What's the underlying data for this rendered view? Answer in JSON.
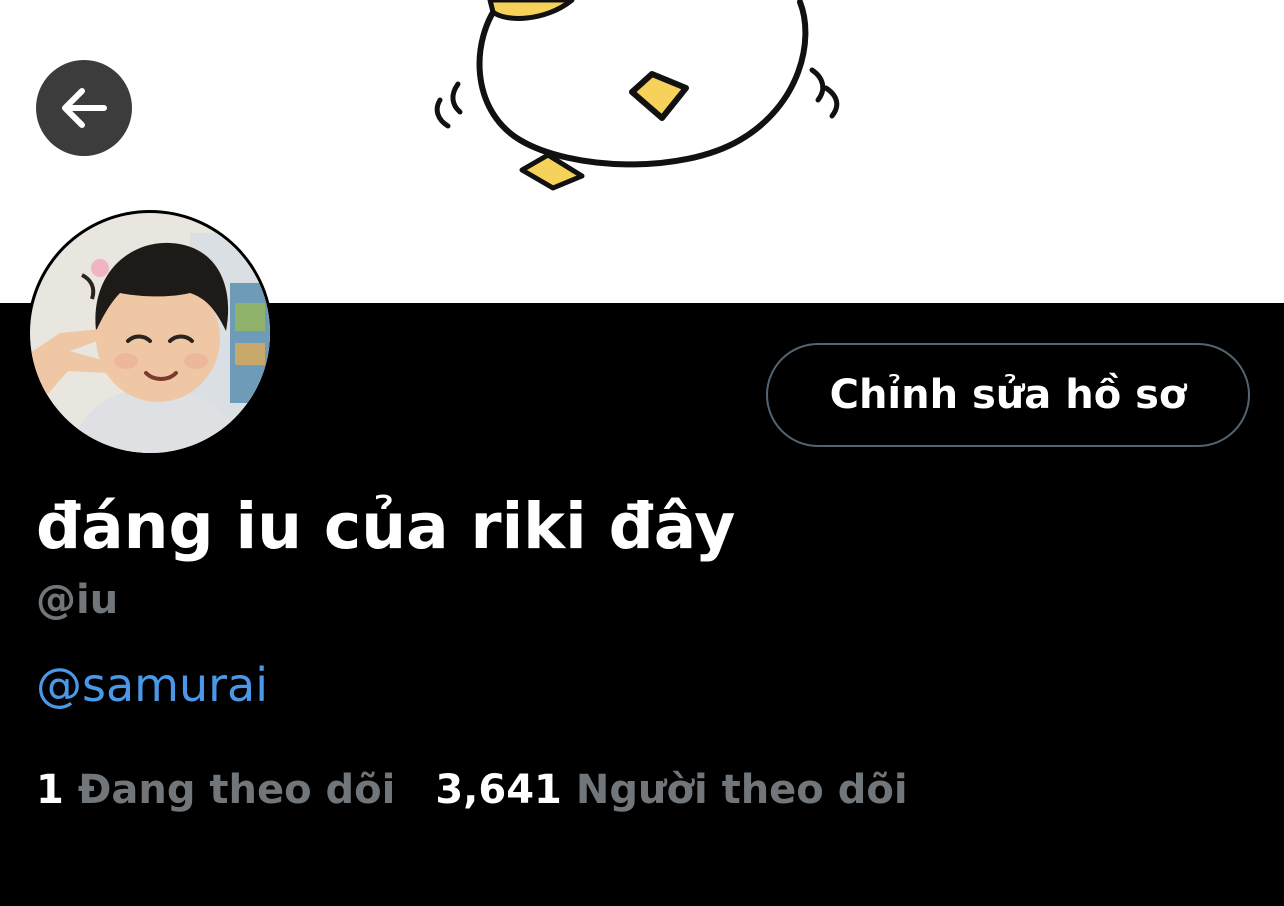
{
  "colors": {
    "background": "#000000",
    "banner_background": "#ffffff",
    "primary_text": "#ffffff",
    "secondary_text": "#71767b",
    "link": "#4a99e9",
    "button_border": "#536471",
    "back_button_bg": "#3c3c3c"
  },
  "header": {
    "back_icon": "arrow-left-icon",
    "banner_image": "cartoon-duck-banner"
  },
  "profile": {
    "avatar_image": "child-photo-avatar",
    "edit_button_label": "Chỉnh sửa hồ sơ",
    "display_name": "đáng iu của riki đây",
    "handle": "@iu",
    "bio_mention": "@samurai"
  },
  "stats": {
    "following_count": "1",
    "following_label": "Đang theo dõi",
    "followers_count": "3,641",
    "followers_label": "Người theo dõi"
  }
}
